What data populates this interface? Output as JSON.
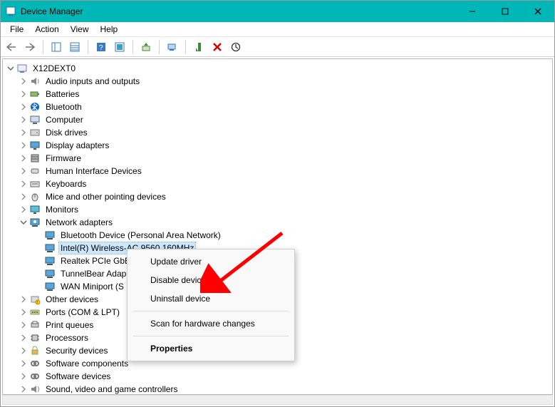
{
  "window": {
    "title": "Device Manager"
  },
  "menu": {
    "file": "File",
    "action": "Action",
    "view": "View",
    "help": "Help"
  },
  "tree": {
    "root": "X12DEXT0",
    "items": [
      {
        "label": "Audio inputs and outputs",
        "icon": "audio"
      },
      {
        "label": "Batteries",
        "icon": "battery"
      },
      {
        "label": "Bluetooth",
        "icon": "bluetooth"
      },
      {
        "label": "Computer",
        "icon": "computer"
      },
      {
        "label": "Disk drives",
        "icon": "disk"
      },
      {
        "label": "Display adapters",
        "icon": "display"
      },
      {
        "label": "Firmware",
        "icon": "firmware"
      },
      {
        "label": "Human Interface Devices",
        "icon": "hid"
      },
      {
        "label": "Keyboards",
        "icon": "keyboard"
      },
      {
        "label": "Mice and other pointing devices",
        "icon": "mouse"
      },
      {
        "label": "Monitors",
        "icon": "monitor"
      },
      {
        "label": "Network adapters",
        "icon": "net",
        "expanded": true,
        "children": [
          {
            "label": "Bluetooth Device (Personal Area Network)"
          },
          {
            "label": "Intel(R) Wireless-AC 9560 160MHz",
            "selected": true
          },
          {
            "label": "Realtek PCIe GbE"
          },
          {
            "label": "TunnelBear Adap"
          },
          {
            "label": "WAN Miniport (S"
          }
        ]
      },
      {
        "label": "Other devices",
        "icon": "other"
      },
      {
        "label": "Ports (COM & LPT)",
        "icon": "port"
      },
      {
        "label": "Print queues",
        "icon": "printer"
      },
      {
        "label": "Processors",
        "icon": "cpu"
      },
      {
        "label": "Security devices",
        "icon": "security"
      },
      {
        "label": "Software components",
        "icon": "swcomp"
      },
      {
        "label": "Software devices",
        "icon": "swdev"
      },
      {
        "label": "Sound, video and game controllers",
        "icon": "sound"
      }
    ]
  },
  "context_menu": {
    "update": "Update driver",
    "disable": "Disable device",
    "uninstall": "Uninstall device",
    "scan": "Scan for hardware changes",
    "properties": "Properties"
  }
}
